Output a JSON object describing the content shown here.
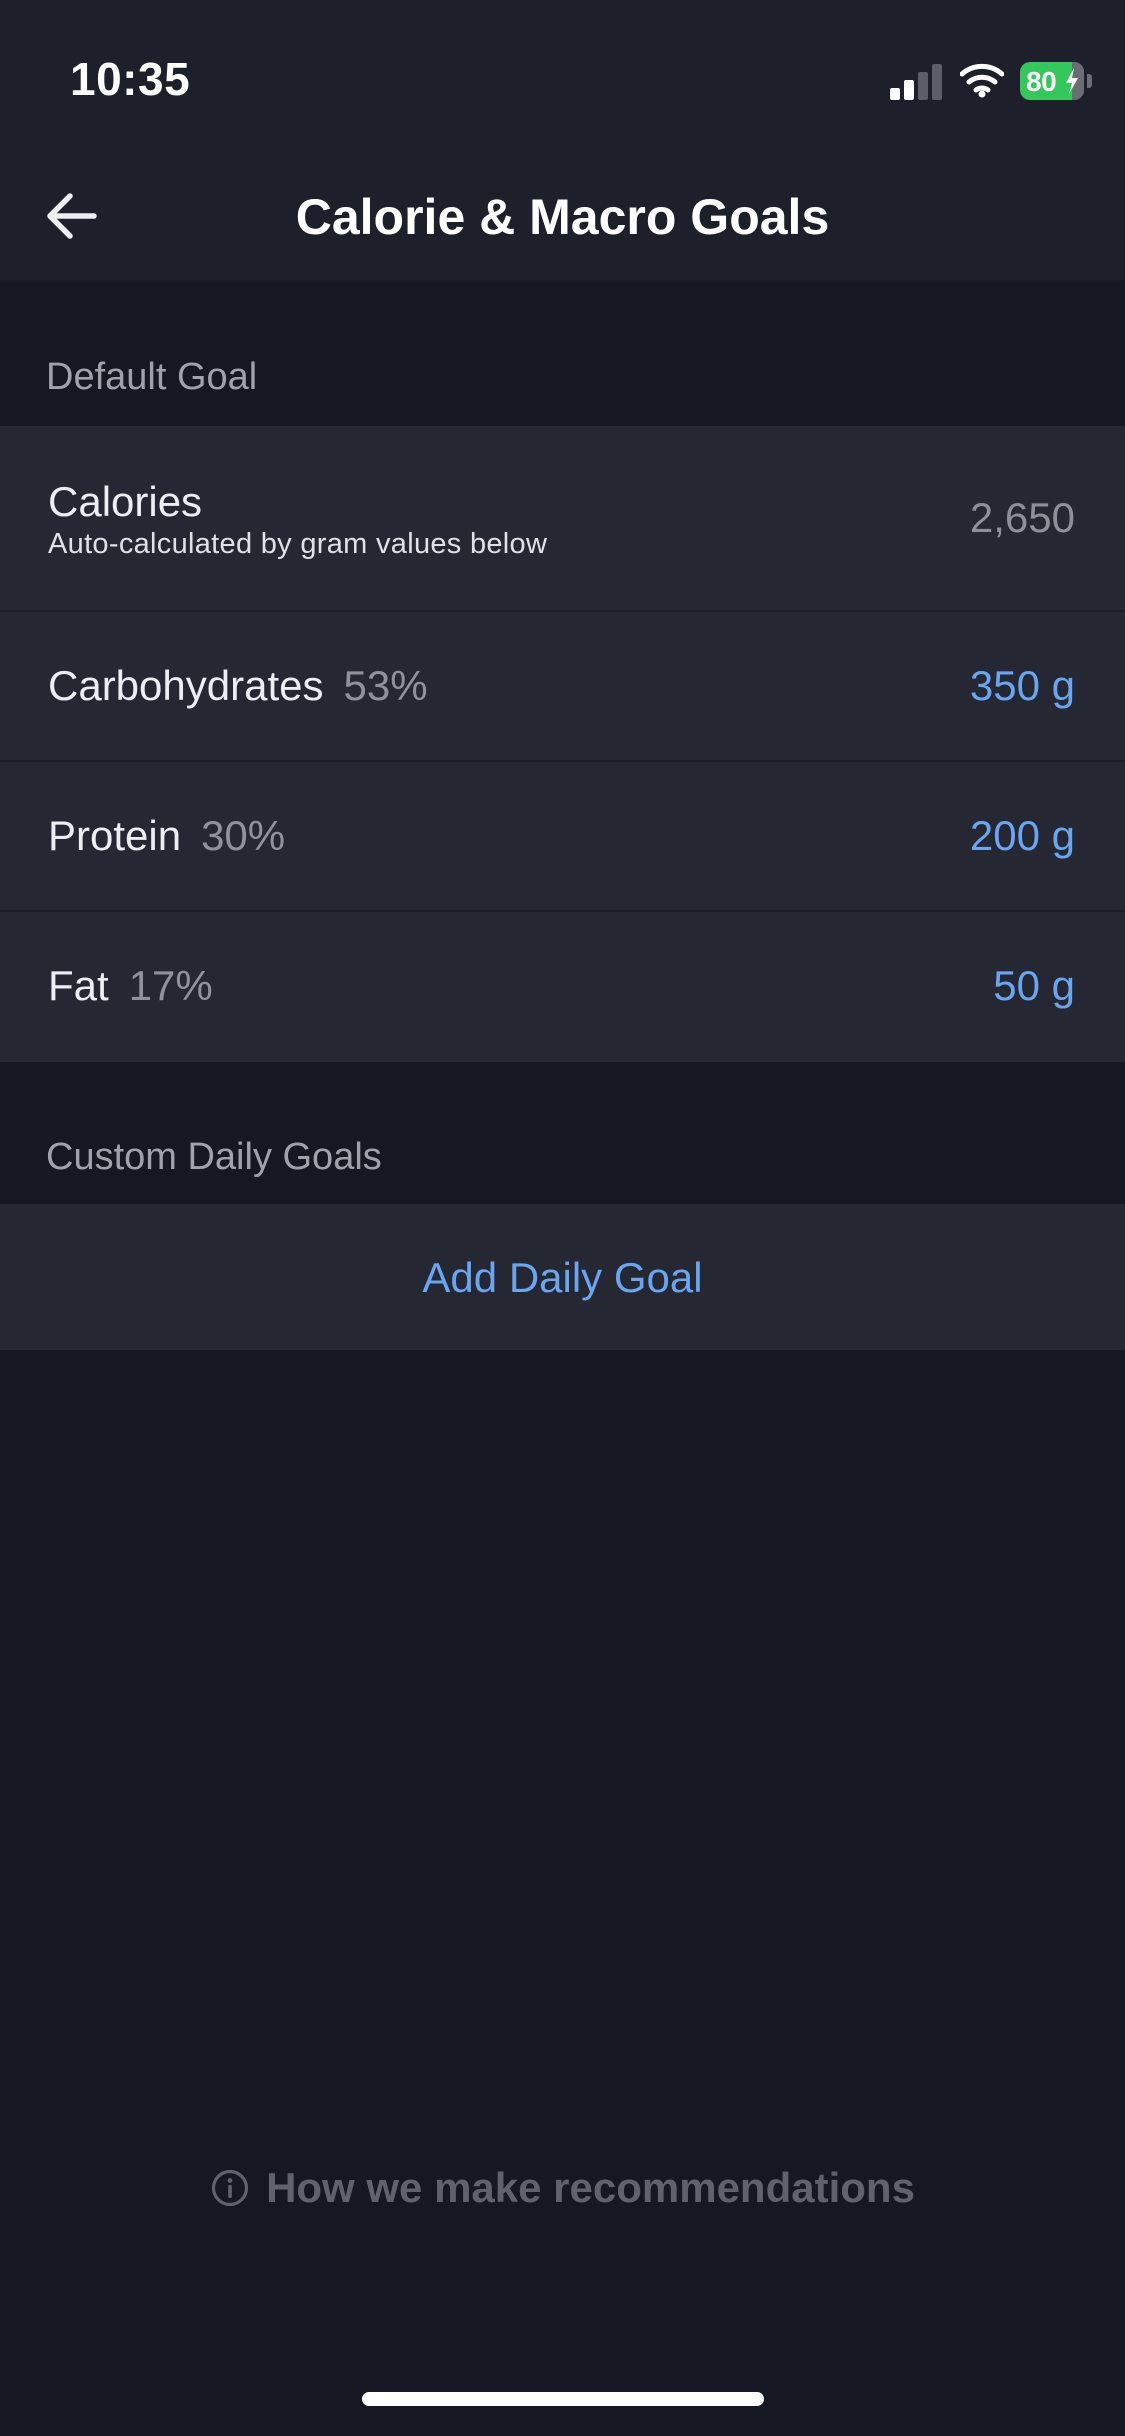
{
  "status_bar": {
    "time": "10:35",
    "battery": "80",
    "battery_color": "#34c759"
  },
  "nav": {
    "title": "Calorie & Macro Goals",
    "back_icon": "arrow-left-icon"
  },
  "default_goal": {
    "header": "Default Goal",
    "calories": {
      "label": "Calories",
      "subtitle": "Auto-calculated by gram values below",
      "value": "2,650"
    },
    "macros": [
      {
        "label": "Carbohydrates",
        "percent": "53%",
        "value": "350 g"
      },
      {
        "label": "Protein",
        "percent": "30%",
        "value": "200 g"
      },
      {
        "label": "Fat",
        "percent": "17%",
        "value": "50 g"
      }
    ]
  },
  "custom_goals": {
    "header": "Custom Daily Goals",
    "add_label": "Add Daily Goal"
  },
  "footer": {
    "recommendations_label": "How we make recommendations",
    "info_icon": "info-circle-icon"
  },
  "colors": {
    "accent": "#6aa6f0",
    "background": "#151723",
    "row_background": "#252733"
  }
}
